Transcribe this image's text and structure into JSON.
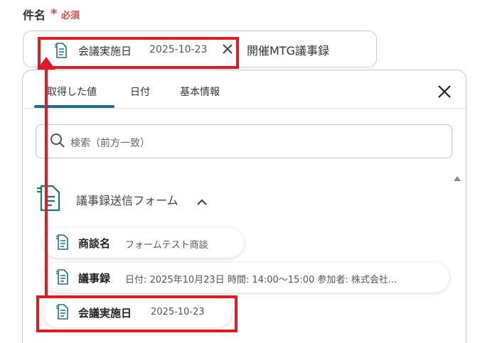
{
  "field": {
    "label": "件名",
    "required_mark": "*",
    "required_text": "必須"
  },
  "input": {
    "chip": {
      "label": "会議実施日",
      "value": "2025-10-23"
    },
    "trailing_text": "開催MTG議事録"
  },
  "panel": {
    "tabs": [
      {
        "label": "取得した値",
        "active": true
      },
      {
        "label": "日付",
        "active": false
      },
      {
        "label": "基本情報",
        "active": false
      }
    ],
    "search": {
      "placeholder": "検索（前方一致）"
    },
    "group": {
      "title": "議事録送信フォーム",
      "expanded": true
    },
    "items": [
      {
        "label": "商談名",
        "value": "フォームテスト商談"
      },
      {
        "label": "議事録",
        "value": "日付: 2025年10月23日 時間: 14:00〜15:00 参加者: 株式会社..."
      },
      {
        "label": "会議実施日",
        "value": "2025-10-23"
      }
    ]
  },
  "colors": {
    "accent": "#1f6f86",
    "required": "#e04848",
    "highlight": "#e01b24"
  },
  "icons": [
    "document-icon",
    "close-icon",
    "search-icon",
    "chevron-up-icon",
    "scroll-up-icon"
  ]
}
